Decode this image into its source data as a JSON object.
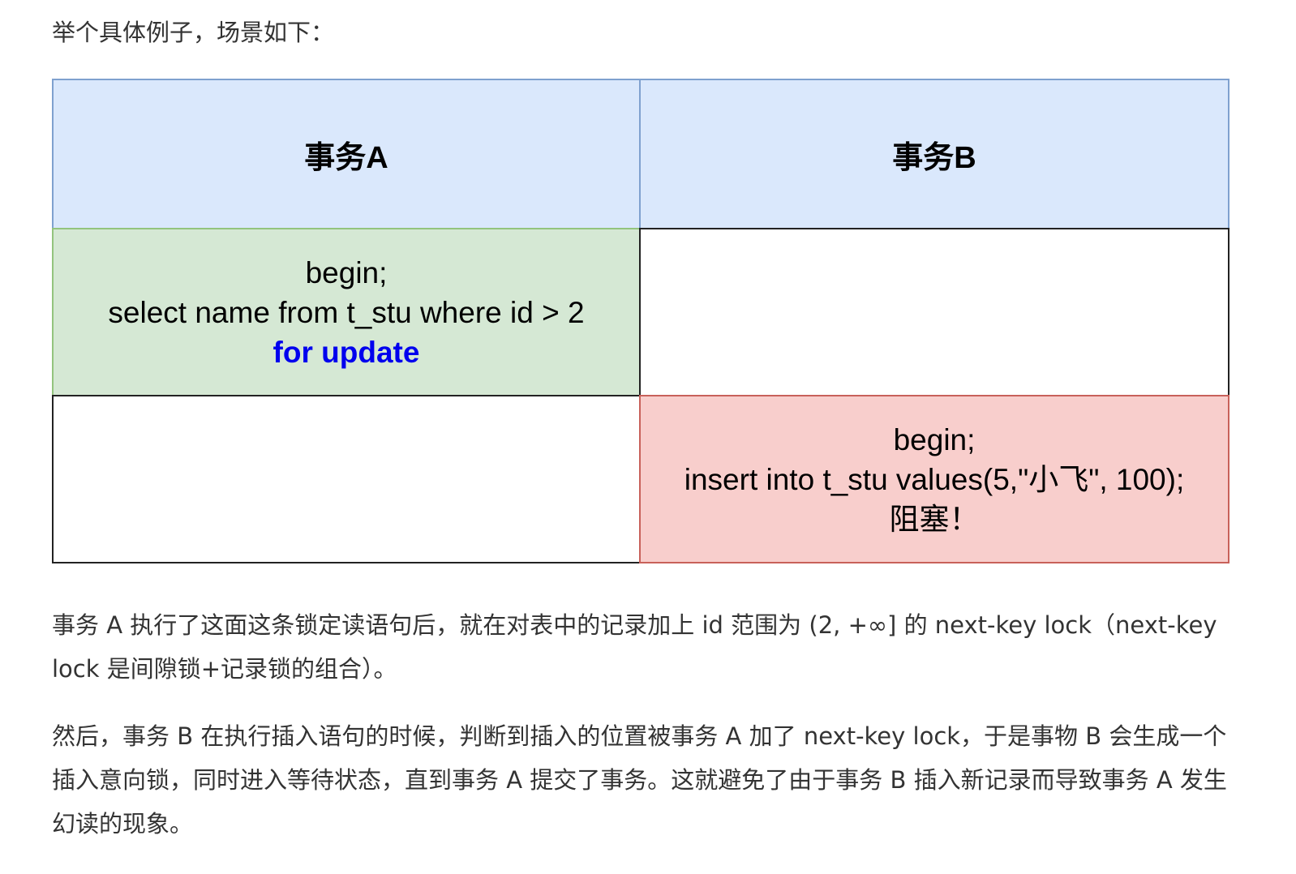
{
  "intro": "举个具体例子，场景如下：",
  "table": {
    "header_a": "事务A",
    "header_b": "事务B",
    "row1_a": {
      "line1": "begin;",
      "line2": "select name from t_stu where id > 2",
      "line3": "for update"
    },
    "row2_b": {
      "line1": "begin;",
      "line2": "insert into t_stu values(5,\"小飞\", 100);",
      "line3": "阻塞！"
    },
    "colors": {
      "header_fill": "#dae8fc",
      "green_fill": "#d5e8d4",
      "red_fill": "#f8cecc",
      "keyword_blue": "#0000ee"
    }
  },
  "paragraph1": "事务 A 执行了这面这条锁定读语句后，就在对表中的记录加上 id 范围为 (2, +∞] 的 next-key lock（next-key lock 是间隙锁+记录锁的组合）。",
  "paragraph2": "然后，事务 B 在执行插入语句的时候，判断到插入的位置被事务 A 加了 next-key lock，于是事物 B 会生成一个插入意向锁，同时进入等待状态，直到事务 A 提交了事务。这就避免了由于事务 B 插入新记录而导致事务 A 发生幻读的现象。"
}
